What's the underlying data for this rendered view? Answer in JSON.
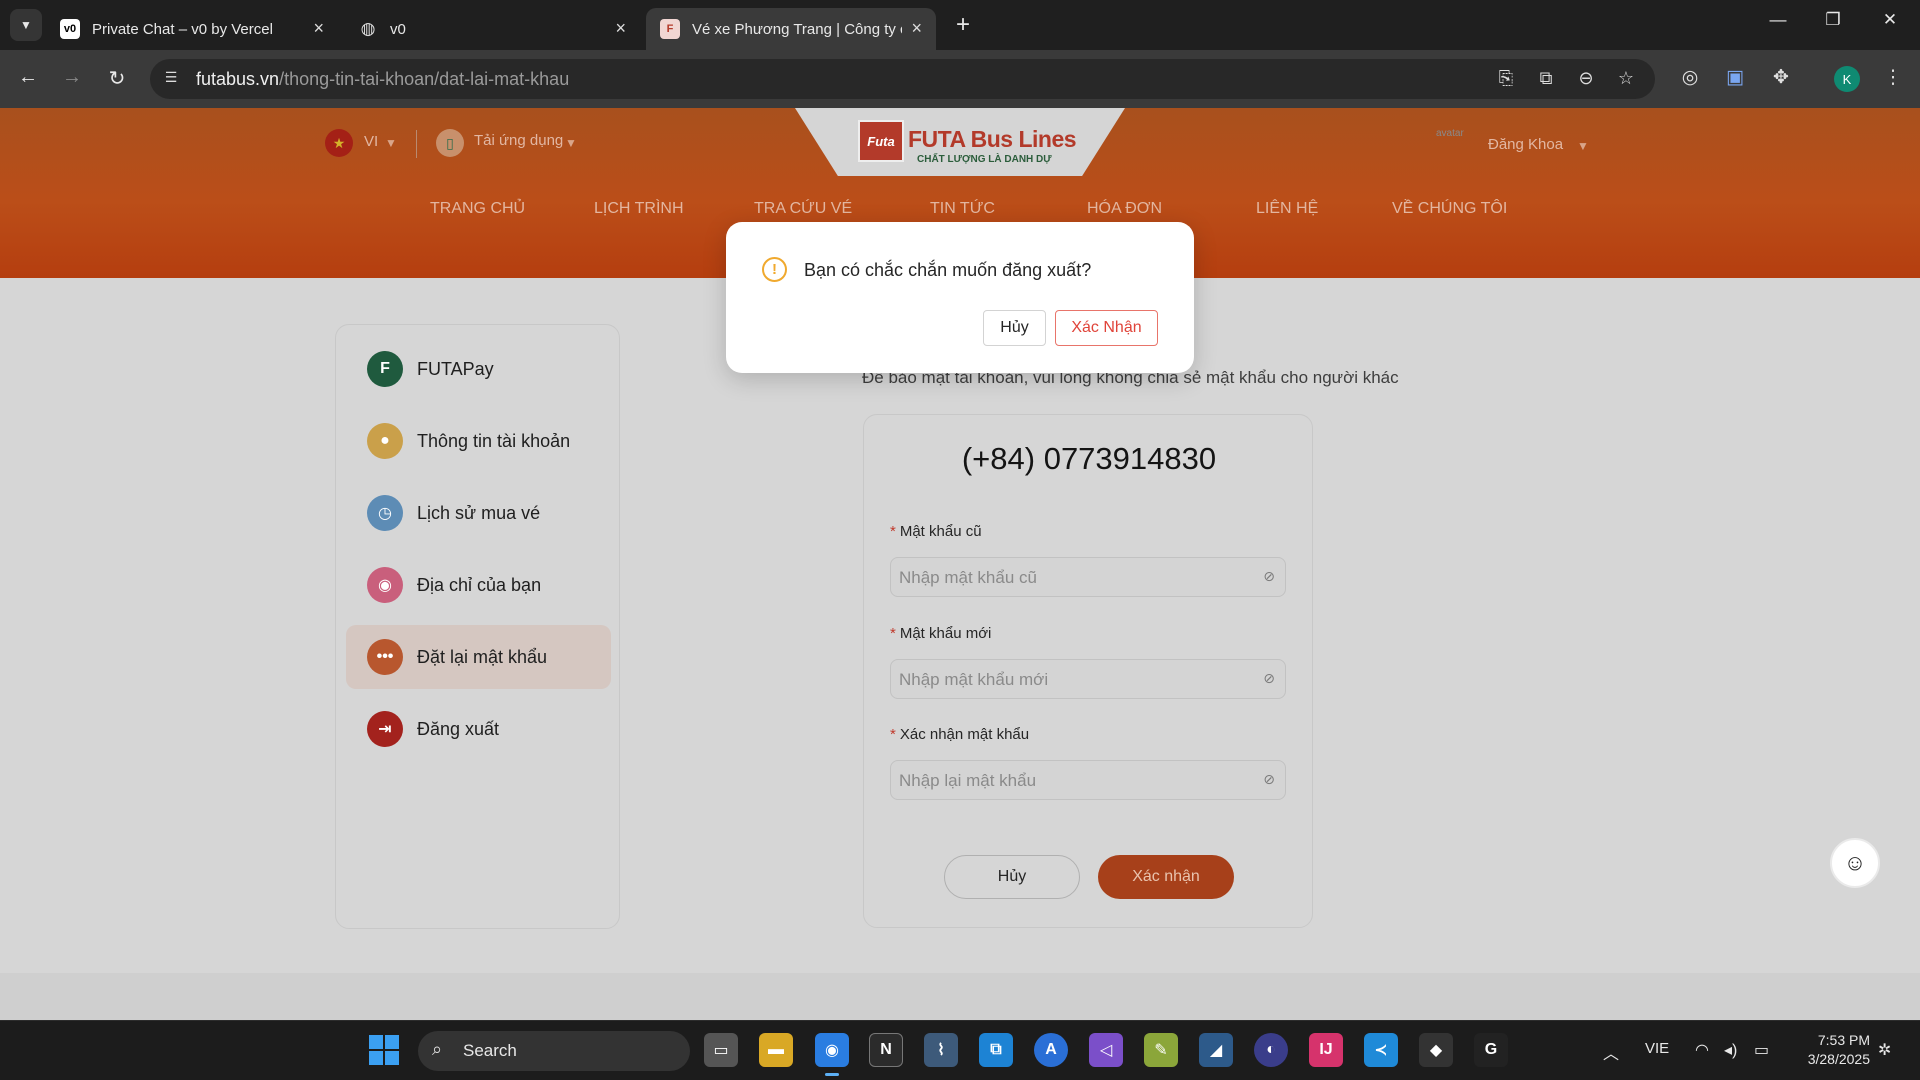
{
  "browser": {
    "tabs": [
      {
        "title": "Private Chat – v0 by Vercel",
        "favicon": "v0",
        "active": false
      },
      {
        "title": "v0",
        "favicon": "globe",
        "active": false
      },
      {
        "title": "Vé xe Phương Trang | Công ty c",
        "favicon": "futa",
        "active": true
      }
    ],
    "new_tab": "+",
    "url_domain": "futabus.vn",
    "url_path": "/thong-tin-tai-khoan/dat-lai-mat-khau",
    "profile_initial": "K"
  },
  "header": {
    "language": "VI",
    "app_label": "Tải ứng dụng",
    "logo_mark": "Futa",
    "logo_title": "FUTA Bus Lines",
    "logo_tagline": "CHẤT LƯỢNG LÀ DANH DỰ",
    "avatar_alt": "avatar",
    "user_name": "Đăng Khoa",
    "menu": [
      "TRANG CHỦ",
      "LỊCH TRÌNH",
      "TRA CỨU VÉ",
      "TIN TỨC",
      "HÓA ĐƠN",
      "LIÊN HỆ",
      "VỀ CHÚNG TÔI"
    ]
  },
  "sidebar": {
    "items": [
      {
        "label": "FUTAPay",
        "icon": "futapay-icon",
        "color": "#1f5a3e",
        "active": false
      },
      {
        "label": "Thông tin tài khoản",
        "icon": "user-icon",
        "color": "#caa04a",
        "active": false
      },
      {
        "label": "Lịch sử mua vé",
        "icon": "history-icon",
        "color": "#5d8cb5",
        "active": false
      },
      {
        "label": "Địa chỉ của bạn",
        "icon": "location-icon",
        "color": "#c95f7c",
        "active": false
      },
      {
        "label": "Đặt lại mật khẩu",
        "icon": "password-icon",
        "color": "#b8572e",
        "active": true
      },
      {
        "label": "Đăng xuất",
        "icon": "logout-icon",
        "color": "#a3221d",
        "active": false
      }
    ]
  },
  "main": {
    "subtitle": "Để bảo mật tài khoản, vui lòng không chia sẻ mật khẩu cho người khác",
    "phone": "(+84) 0773914830",
    "fields": [
      {
        "label": "Mật khẩu cũ",
        "placeholder": "Nhập mật khẩu cũ"
      },
      {
        "label": "Mật khẩu mới",
        "placeholder": "Nhập mật khẩu mới"
      },
      {
        "label": "Xác nhận mật khẩu",
        "placeholder": "Nhập lại mật khẩu"
      }
    ],
    "cancel_label": "Hủy",
    "confirm_label": "Xác nhận"
  },
  "dialog": {
    "message": "Bạn có chắc chắn muốn đăng xuất?",
    "cancel_label": "Hủy",
    "confirm_label": "Xác Nhận"
  },
  "taskbar": {
    "search_label": "Search",
    "language": "VIE",
    "time": "7:53 PM",
    "date": "3/28/2025"
  },
  "colors": {
    "brand_orange": "#ef5222",
    "dialog_warning": "#f0a92e",
    "dialog_danger": "#e0443a"
  }
}
